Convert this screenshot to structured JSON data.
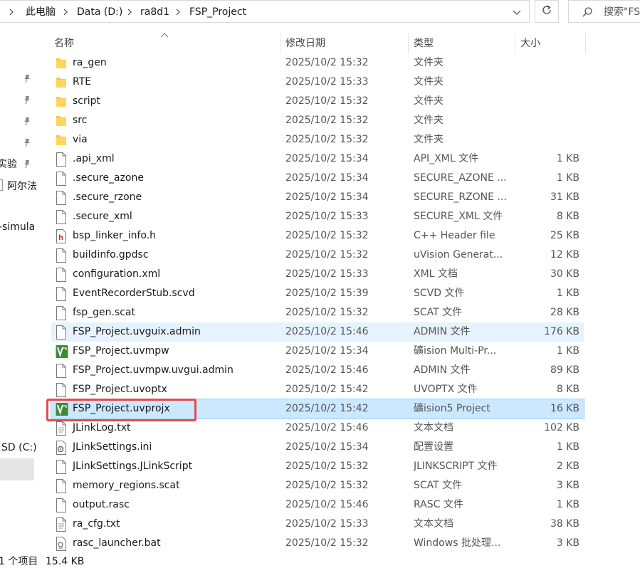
{
  "breadcrumb": {
    "items": [
      "此电脑",
      "Data (D:)",
      "ra8d1",
      "FSP_Project"
    ]
  },
  "search": {
    "placeholder": "搜索\"FS"
  },
  "columns": {
    "name": "名称",
    "modified": "修改日期",
    "type": "类型",
    "size": "大小"
  },
  "nav": {
    "partial_labels": [
      "实验",
      "阿尔法",
      "-simula",
      "SD (C:)"
    ]
  },
  "files": [
    {
      "name": "ra_gen",
      "modified": "2025/10/2 15:32",
      "type": "文件夹",
      "size": "",
      "icon": "folder-icon"
    },
    {
      "name": "RTE",
      "modified": "2025/10/2 15:33",
      "type": "文件夹",
      "size": "",
      "icon": "folder-icon"
    },
    {
      "name": "script",
      "modified": "2025/10/2 15:32",
      "type": "文件夹",
      "size": "",
      "icon": "folder-icon"
    },
    {
      "name": "src",
      "modified": "2025/10/2 15:32",
      "type": "文件夹",
      "size": "",
      "icon": "folder-icon"
    },
    {
      "name": "via",
      "modified": "2025/10/2 15:32",
      "type": "文件夹",
      "size": "",
      "icon": "folder-icon"
    },
    {
      "name": ".api_xml",
      "modified": "2025/10/2 15:34",
      "type": "API_XML 文件",
      "size": "1 KB",
      "icon": "file-icon"
    },
    {
      "name": ".secure_azone",
      "modified": "2025/10/2 15:34",
      "type": "SECURE_AZONE ...",
      "size": "1 KB",
      "icon": "file-icon"
    },
    {
      "name": ".secure_rzone",
      "modified": "2025/10/2 15:34",
      "type": "SECURE_RZONE ...",
      "size": "31 KB",
      "icon": "file-icon"
    },
    {
      "name": ".secure_xml",
      "modified": "2025/10/2 15:33",
      "type": "SECURE_XML 文件",
      "size": "8 KB",
      "icon": "file-icon"
    },
    {
      "name": "bsp_linker_info.h",
      "modified": "2025/10/2 15:32",
      "type": "C++ Header file",
      "size": "25 KB",
      "icon": "header-file-icon"
    },
    {
      "name": "buildinfo.gpdsc",
      "modified": "2025/10/2 15:32",
      "type": "uVision Generat...",
      "size": "12 KB",
      "icon": "file-icon"
    },
    {
      "name": "configuration.xml",
      "modified": "2025/10/2 15:33",
      "type": "XML 文档",
      "size": "30 KB",
      "icon": "file-icon"
    },
    {
      "name": "EventRecorderStub.scvd",
      "modified": "2025/10/2 15:39",
      "type": "SCVD 文件",
      "size": "1 KB",
      "icon": "file-icon"
    },
    {
      "name": "fsp_gen.scat",
      "modified": "2025/10/2 15:32",
      "type": "SCAT 文件",
      "size": "28 KB",
      "icon": "file-icon"
    },
    {
      "name": "FSP_Project.uvguix.admin",
      "modified": "2025/10/2 15:46",
      "type": "ADMIN 文件",
      "size": "176 KB",
      "icon": "file-icon",
      "state": "hover"
    },
    {
      "name": "FSP_Project.uvmpw",
      "modified": "2025/10/2 15:34",
      "type": "礦ision Multi-Pr...",
      "size": "1 KB",
      "icon": "uvision-icon"
    },
    {
      "name": "FSP_Project.uvmpw.uvgui.admin",
      "modified": "2025/10/2 15:46",
      "type": "ADMIN 文件",
      "size": "89 KB",
      "icon": "file-icon"
    },
    {
      "name": "FSP_Project.uvoptx",
      "modified": "2025/10/2 15:42",
      "type": "UVOPTX 文件",
      "size": "8 KB",
      "icon": "file-icon"
    },
    {
      "name": "FSP_Project.uvprojx",
      "modified": "2025/10/2 15:42",
      "type": "礦ision5 Project",
      "size": "16 KB",
      "icon": "uvision-icon",
      "state": "selected"
    },
    {
      "name": "JLinkLog.txt",
      "modified": "2025/10/2 15:46",
      "type": "文本文档",
      "size": "102 KB",
      "icon": "text-file-icon"
    },
    {
      "name": "JLinkSettings.ini",
      "modified": "2025/10/2 15:34",
      "type": "配置设置",
      "size": "1 KB",
      "icon": "settings-file-icon"
    },
    {
      "name": "JLinkSettings.JLinkScript",
      "modified": "2025/10/2 15:32",
      "type": "JLINKSCRIPT 文件",
      "size": "2 KB",
      "icon": "file-icon"
    },
    {
      "name": "memory_regions.scat",
      "modified": "2025/10/2 15:32",
      "type": "SCAT 文件",
      "size": "3 KB",
      "icon": "file-icon"
    },
    {
      "name": "output.rasc",
      "modified": "2025/10/2 15:46",
      "type": "RASC 文件",
      "size": "1 KB",
      "icon": "file-icon"
    },
    {
      "name": "ra_cfg.txt",
      "modified": "2025/10/2 15:33",
      "type": "文本文档",
      "size": "38 KB",
      "icon": "text-file-icon"
    },
    {
      "name": "rasc_launcher.bat",
      "modified": "2025/10/2 15:32",
      "type": "Windows 批处理...",
      "size": "3 KB",
      "icon": "batch-file-icon"
    }
  ],
  "status": {
    "count": "1 个项目",
    "size": "15.4 KB"
  },
  "colors": {
    "selected_bg": "#cce8ff",
    "hover_bg": "#e5f3ff",
    "highlight_box": "#e84a4a",
    "folder": "#f8c846"
  }
}
